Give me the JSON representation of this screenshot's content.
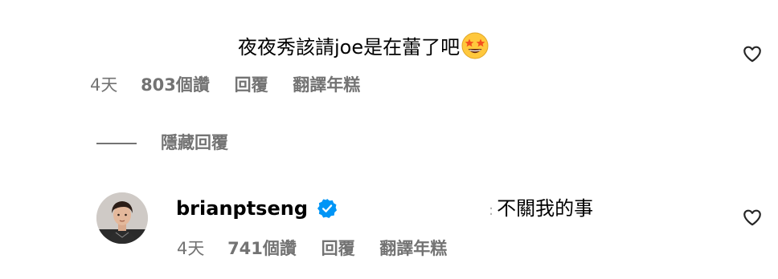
{
  "comment": {
    "text": "夜夜秀該請joe是在蕾了吧",
    "emoji_icon": "star-struck-emoji-icon",
    "time": "4天",
    "likes": "803個讚",
    "reply_label": "回覆",
    "translate_label": "翻譯年糕"
  },
  "hide_replies": {
    "label": "隱藏回覆"
  },
  "reply": {
    "username": "brianptseng",
    "verified_icon": "verified-badge-icon",
    "separator": ":",
    "text": "不關我的事",
    "time": "4天",
    "likes": "741個讚",
    "reply_label": "回覆",
    "translate_label": "翻譯年糕"
  },
  "colors": {
    "meta_gray": "#737373",
    "verified_blue": "#0095f6",
    "emoji_yellow": "#FFC83D"
  }
}
